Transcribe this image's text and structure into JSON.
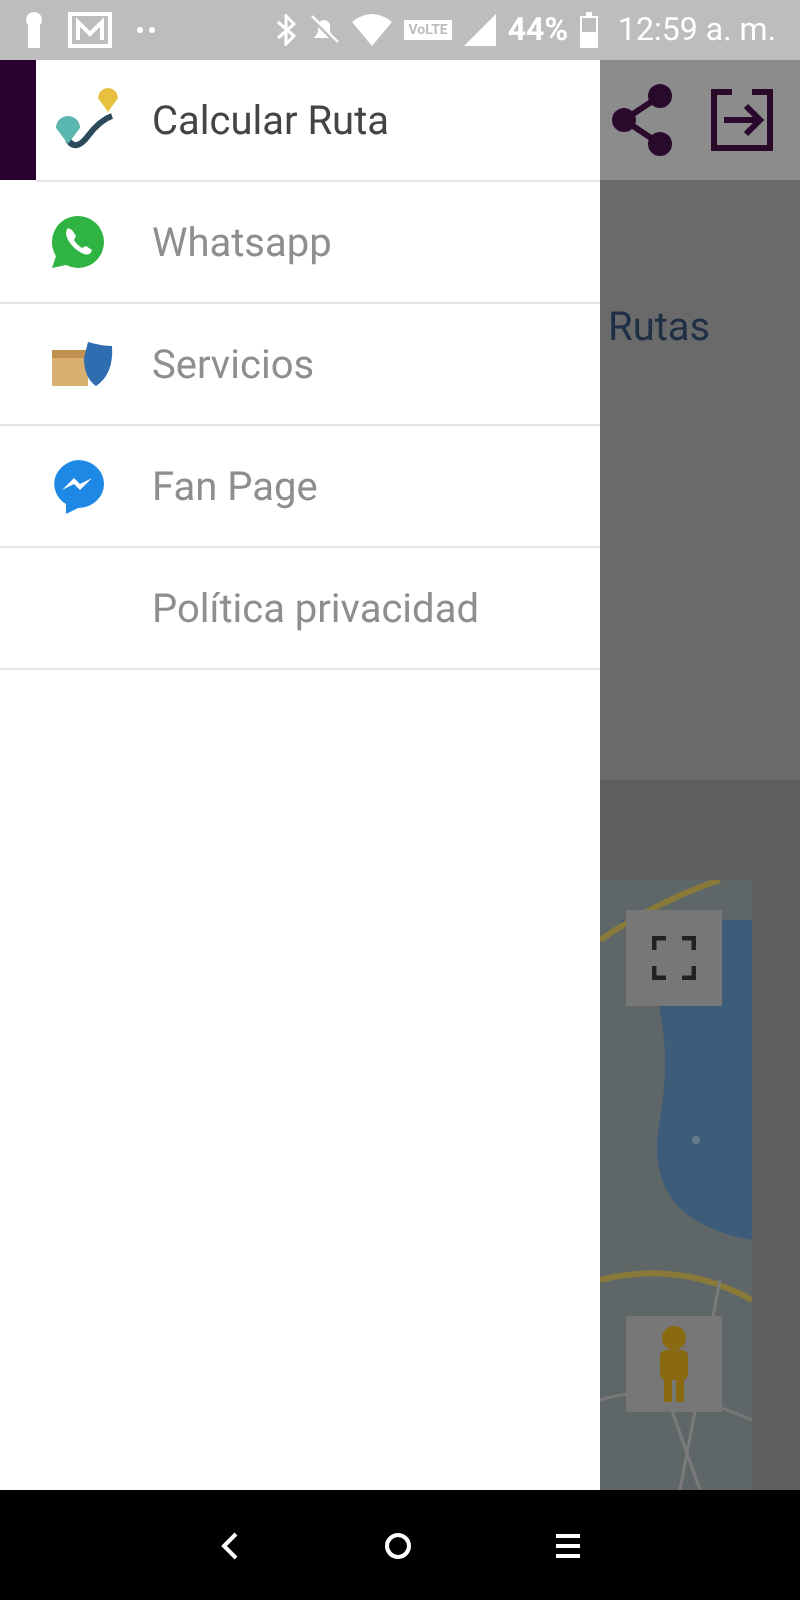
{
  "status_bar": {
    "volte": "VoLTE",
    "battery": "44%",
    "time": "12:59 a. m."
  },
  "background_app": {
    "card_text": "Rutas"
  },
  "drawer": {
    "items": [
      {
        "label": "Calcular Ruta",
        "selected": true
      },
      {
        "label": "Whatsapp",
        "selected": false
      },
      {
        "label": "Servicios",
        "selected": false
      },
      {
        "label": "Fan Page",
        "selected": false
      },
      {
        "label": "Política privacidad",
        "selected": false
      }
    ]
  }
}
